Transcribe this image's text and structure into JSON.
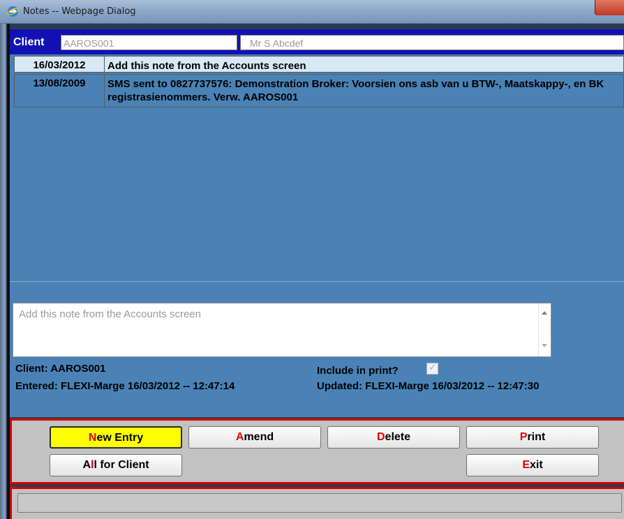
{
  "window": {
    "title": "Notes -- Webpage Dialog"
  },
  "client": {
    "label": "Client",
    "code": "AAROS001",
    "name": "Mr S Abcdef"
  },
  "notes": [
    {
      "date": "16/03/2012",
      "text": "Add this note from the Accounts screen"
    },
    {
      "date": "13/08/2009",
      "text": "SMS sent to 0827737576: Demonstration Broker: Voorsien ons asb van u BTW-, Maatskappy-, en BK registrasienommers. Verw. AAROS001"
    }
  ],
  "detail": {
    "note_text": "Add this note from the Accounts screen",
    "client_line": "Client: AAROS001",
    "entered_line": "Entered:  FLEXI-Marge  16/03/2012 -- 12:47:14",
    "include_label": "Include in print?",
    "include_checked": true,
    "updated_line": "Updated:  FLEXI-Marge  16/03/2012 -- 12:47:30"
  },
  "buttons": {
    "new_entry": {
      "hotkey": "N",
      "rest": "ew Entry"
    },
    "amend": {
      "hotkey": "A",
      "rest": "mend"
    },
    "delete": {
      "hotkey": "D",
      "rest": "elete"
    },
    "print": {
      "hotkey": "P",
      "rest": "rint"
    },
    "all_for_client": {
      "pre": "A",
      "hotkey": "l",
      "rest": "l for Client"
    },
    "exit": {
      "hotkey": "E",
      "rest": "xit"
    }
  },
  "status": {
    "text": ""
  },
  "colors": {
    "panel_blue": "#4a82b6",
    "client_bar": "#1212b4",
    "button_highlight": "#ffff00",
    "hotkey": "#e00000",
    "frame_red": "#d40000"
  }
}
